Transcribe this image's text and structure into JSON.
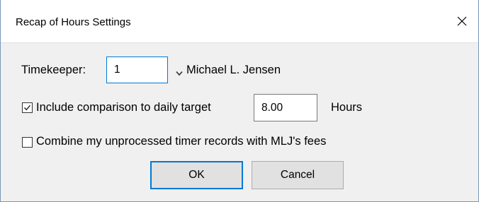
{
  "window": {
    "title": "Recap of Hours Settings"
  },
  "timekeeper": {
    "label": "Timekeeper:",
    "value": "1",
    "name": "Michael L. Jensen"
  },
  "comparison": {
    "checked": true,
    "label": "Include comparison to daily target",
    "value": "8.00",
    "unit": "Hours"
  },
  "combine": {
    "checked": false,
    "label": "Combine my unprocessed timer records with MLJ's fees"
  },
  "buttons": {
    "ok": "OK",
    "cancel": "Cancel"
  },
  "icons": {
    "close": "close-icon",
    "dropdown": "chevron-down-icon",
    "check": "checkmark-icon"
  }
}
